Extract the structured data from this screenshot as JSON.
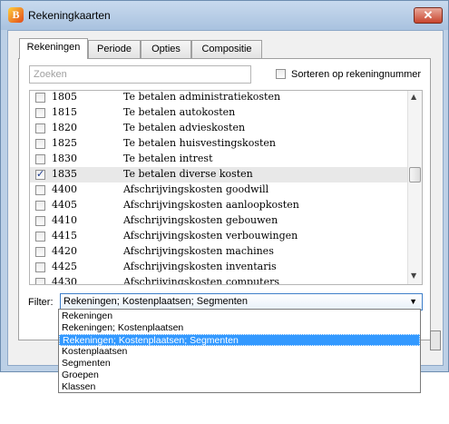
{
  "window": {
    "title": "Rekeningkaarten",
    "close_symbol": "✕"
  },
  "tabs": [
    {
      "label": "Rekeningen",
      "active": true
    },
    {
      "label": "Periode",
      "active": false
    },
    {
      "label": "Opties",
      "active": false
    },
    {
      "label": "Compositie",
      "active": false
    }
  ],
  "search": {
    "placeholder": "Zoeken",
    "value": ""
  },
  "sort_option": {
    "label": "Sorteren op rekeningnummer",
    "checked": false
  },
  "accounts": [
    {
      "number": "1805",
      "description": "Te betalen administratiekosten",
      "checked": false
    },
    {
      "number": "1815",
      "description": "Te betalen autokosten",
      "checked": false
    },
    {
      "number": "1820",
      "description": "Te betalen advieskosten",
      "checked": false
    },
    {
      "number": "1825",
      "description": "Te betalen huisvestingskosten",
      "checked": false
    },
    {
      "number": "1830",
      "description": "Te betalen intrest",
      "checked": false
    },
    {
      "number": "1835",
      "description": "Te betalen diverse kosten",
      "checked": true
    },
    {
      "number": "4400",
      "description": "Afschrijvingskosten goodwill",
      "checked": false
    },
    {
      "number": "4405",
      "description": "Afschrijvingskosten aanloopkosten",
      "checked": false
    },
    {
      "number": "4410",
      "description": "Afschrijvingskosten gebouwen",
      "checked": false
    },
    {
      "number": "4415",
      "description": "Afschrijvingskosten verbouwingen",
      "checked": false
    },
    {
      "number": "4420",
      "description": "Afschrijvingskosten machines",
      "checked": false
    },
    {
      "number": "4425",
      "description": "Afschrijvingskosten inventaris",
      "checked": false
    },
    {
      "number": "4430",
      "description": "Afschrijvingskosten computers",
      "checked": false
    }
  ],
  "scrollbar": {
    "up_icon": "▲",
    "down_icon": "▼"
  },
  "filter": {
    "label": "Filter:",
    "selected": "Rekeningen; Kostenplaatsen; Segmenten",
    "chevron_icon": "▼",
    "options": [
      "Rekeningen",
      "Rekeningen; Kostenplaatsen",
      "Rekeningen; Kostenplaatsen; Segmenten",
      "Kostenplaatsen",
      "Segmenten",
      "Groepen",
      "Klassen"
    ],
    "highlighted_index": 2
  }
}
